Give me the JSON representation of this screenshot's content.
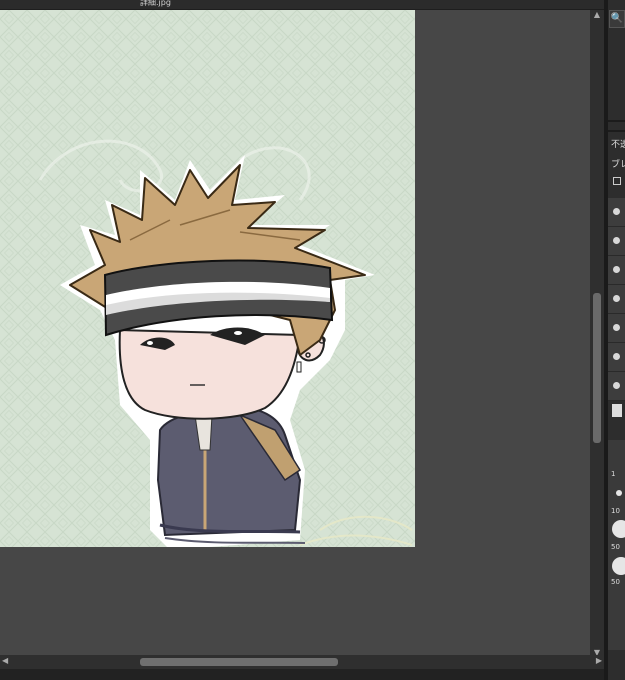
{
  "document": {
    "tab_title": "詳細.jpg"
  },
  "panel": {
    "zoom_icon": "zoom-icon",
    "label_1": "不透",
    "label_2": "ブレ",
    "checkbox_label": "□",
    "list_rows": 7,
    "brush_sizes": [
      "1",
      "10",
      "50",
      "50"
    ]
  },
  "colors": {
    "canvas_bg": "#d6e3d4",
    "ui_bg": "#474747",
    "panel_bg": "#2d2d2d",
    "hair": "#c9a676",
    "headband_dark": "#4a4a4a",
    "skin": "#f6e1dc",
    "jacket": "#5c5c70"
  }
}
